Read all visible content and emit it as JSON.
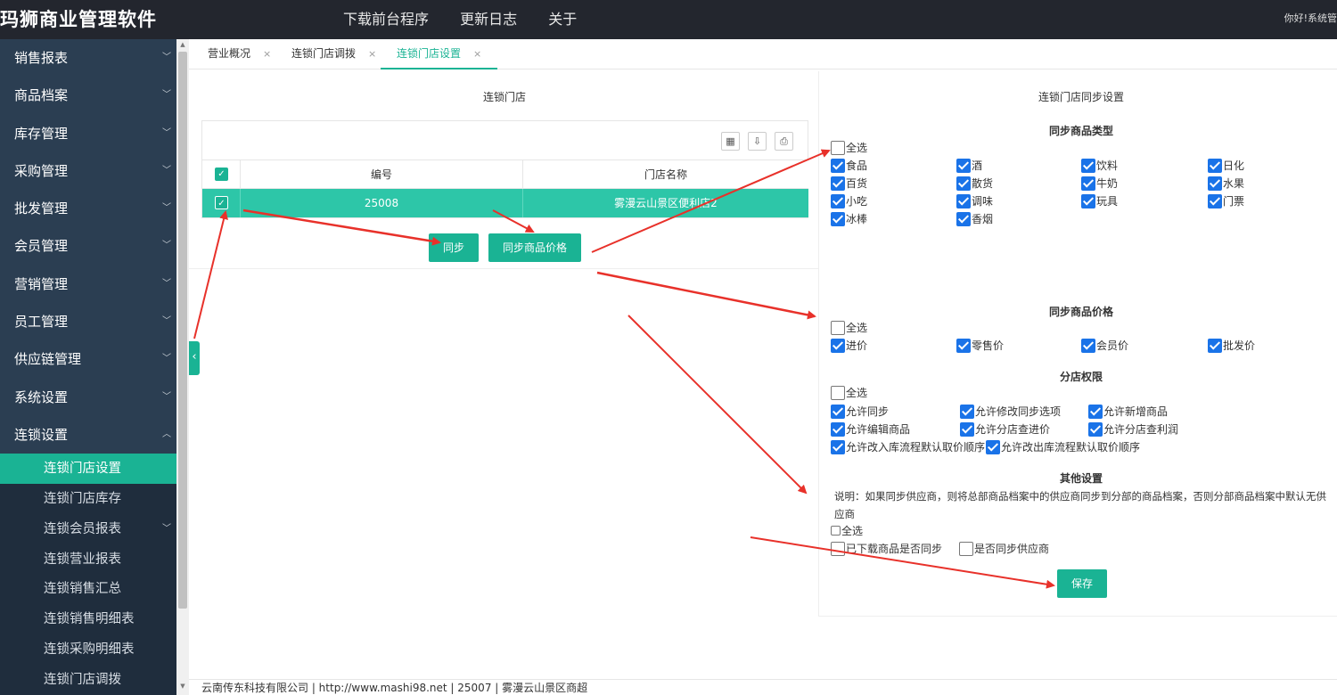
{
  "header": {
    "brand": "玛狮商业管理软件",
    "nav": [
      "下载前台程序",
      "更新日志",
      "关于"
    ],
    "greeting": "你好!系统管"
  },
  "sidebar": {
    "items": [
      {
        "label": "销售报表"
      },
      {
        "label": "商品档案"
      },
      {
        "label": "库存管理"
      },
      {
        "label": "采购管理"
      },
      {
        "label": "批发管理"
      },
      {
        "label": "会员管理"
      },
      {
        "label": "营销管理"
      },
      {
        "label": "员工管理"
      },
      {
        "label": "供应链管理"
      },
      {
        "label": "系统设置"
      },
      {
        "label": "连锁设置"
      }
    ],
    "subitems": [
      {
        "label": "连锁门店设置"
      },
      {
        "label": "连锁门店库存"
      },
      {
        "label": "连锁会员报表"
      },
      {
        "label": "连锁营业报表"
      },
      {
        "label": "连锁销售汇总"
      },
      {
        "label": "连锁销售明细表"
      },
      {
        "label": "连锁采购明细表"
      },
      {
        "label": "连锁门店调拨"
      }
    ]
  },
  "tabs": [
    {
      "label": "营业概况"
    },
    {
      "label": "连锁门店调拨"
    },
    {
      "label": "连锁门店设置"
    }
  ],
  "tab_close": "×",
  "left": {
    "title": "连锁门店",
    "toolbar_icons": [
      "columns-icon",
      "export-icon",
      "print-icon"
    ],
    "columns": [
      "编号",
      "门店名称"
    ],
    "rows": [
      {
        "code": "25008",
        "name": "雾漫云山景区便利店2"
      }
    ],
    "sync_button": "同步",
    "sync_price_button": "同步商品价格"
  },
  "right": {
    "title": "连锁门店同步设置",
    "types_title": "同步商品类型",
    "select_all": "全选",
    "types": [
      "食品",
      "酒",
      "饮料",
      "日化",
      "百货",
      "散货",
      "牛奶",
      "水果",
      "小吃",
      "调味",
      "玩具",
      "门票",
      "冰棒",
      "香烟"
    ],
    "price_title": "同步商品价格",
    "prices": [
      "进价",
      "零售价",
      "会员价",
      "批发价"
    ],
    "perm_title": "分店权限",
    "perms": [
      "允许同步",
      "允许修改同步选项",
      "允许新增商品",
      "允许编辑商品",
      "允许分店查进价",
      "允许分店查利润",
      "允许改入库流程默认取价顺序",
      "允许改出库流程默认取价顺序"
    ],
    "other_title": "其他设置",
    "note": "说明：如果同步供应商，则将总部商品档案中的供应商同步到分部的商品档案，否则分部商品档案中默认无供应商",
    "other_opts": [
      "已下载商品是否同步",
      "是否同步供应商"
    ],
    "save_button": "保存"
  },
  "footer": "云南传东科技有限公司 | http://www.mashi98.net | 25007 | 雾漫云山景区商超",
  "colors": {
    "accent": "#1ab394",
    "sidebar": "#2b3e52",
    "topbar": "#23262e",
    "checkbox": "#1a73e8",
    "arrow": "#e8312a"
  }
}
